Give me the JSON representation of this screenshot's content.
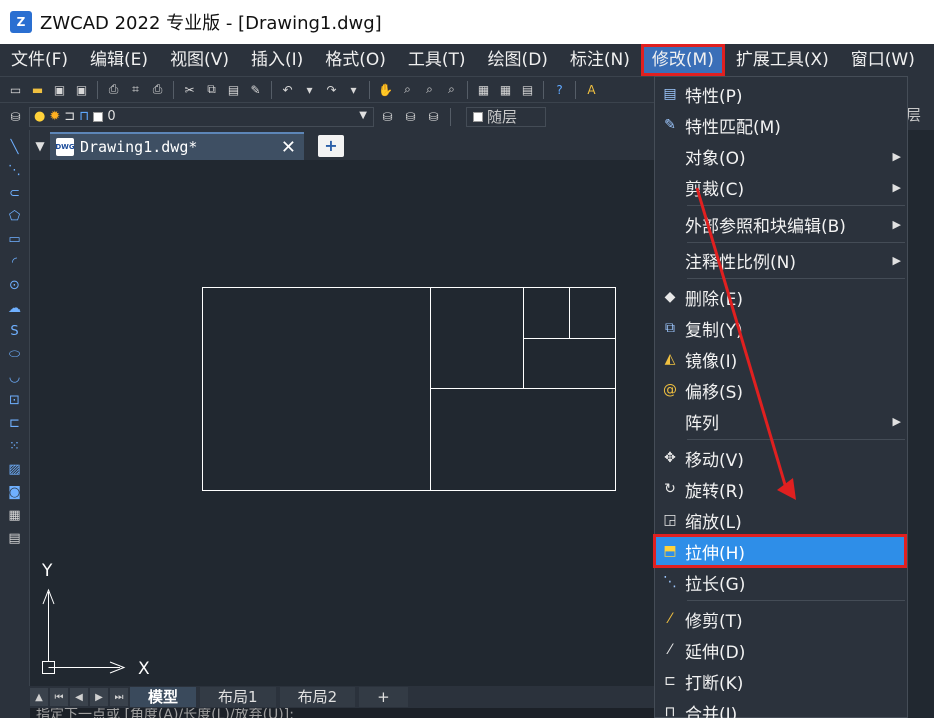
{
  "window": {
    "title": "ZWCAD 2022 专业版 - [Drawing1.dwg]"
  },
  "menubar": [
    {
      "label": "文件(F)"
    },
    {
      "label": "编辑(E)"
    },
    {
      "label": "视图(V)"
    },
    {
      "label": "插入(I)"
    },
    {
      "label": "格式(O)"
    },
    {
      "label": "工具(T)"
    },
    {
      "label": "绘图(D)"
    },
    {
      "label": "标注(N)"
    },
    {
      "label": "修改(M)"
    },
    {
      "label": "扩展工具(X)"
    },
    {
      "label": "窗口(W)"
    }
  ],
  "toolbar": {
    "layer_value": "0",
    "bylayer_label": "随层",
    "right_edge_text": "层"
  },
  "tabs": {
    "doc_tab_label": "Drawing1.dwg*",
    "dwg_icon_text": "DWG",
    "close_glyph": "✕",
    "new_tab_glyph": "+"
  },
  "layout_tabs": [
    {
      "label": "模型"
    },
    {
      "label": "布局1"
    },
    {
      "label": "布局2"
    },
    {
      "label": "+"
    }
  ],
  "ucs": {
    "x_label": "X",
    "y_label": "Y"
  },
  "command_line": {
    "text": "指定下一点或 [角度(A)/长度(L)/放弃(U)]:"
  },
  "modify_menu": [
    {
      "label": "特性(P)",
      "icon": "properties-icon"
    },
    {
      "label": "特性匹配(M)",
      "icon": "match-properties-icon"
    },
    {
      "label": "对象(O)",
      "submenu": true
    },
    {
      "label": "剪裁(C)",
      "submenu": true
    },
    {
      "label": "外部参照和块编辑(B)",
      "submenu": true
    },
    {
      "label": "注释性比例(N)",
      "submenu": true
    },
    {
      "label": "删除(E)",
      "icon": "eraser-icon"
    },
    {
      "label": "复制(Y)",
      "icon": "copy-icon"
    },
    {
      "label": "镜像(I)",
      "icon": "mirror-icon"
    },
    {
      "label": "偏移(S)",
      "icon": "offset-icon"
    },
    {
      "label": "阵列",
      "submenu": true
    },
    {
      "label": "移动(V)",
      "icon": "move-icon"
    },
    {
      "label": "旋转(R)",
      "icon": "rotate-icon"
    },
    {
      "label": "缩放(L)",
      "icon": "scale-icon"
    },
    {
      "label": "拉伸(H)",
      "icon": "stretch-icon",
      "highlighted": true
    },
    {
      "label": "拉长(G)",
      "icon": "lengthen-icon"
    },
    {
      "label": "修剪(T)",
      "icon": "trim-icon"
    },
    {
      "label": "延伸(D)",
      "icon": "extend-icon"
    },
    {
      "label": "打断(K)",
      "icon": "break-icon"
    },
    {
      "label": "合并(J)",
      "icon": "join-icon"
    }
  ],
  "colors": {
    "highlight": "#2e8ee8",
    "annotation_red": "#e02020",
    "menu_bg": "#2b323c",
    "canvas_bg": "#212830"
  }
}
